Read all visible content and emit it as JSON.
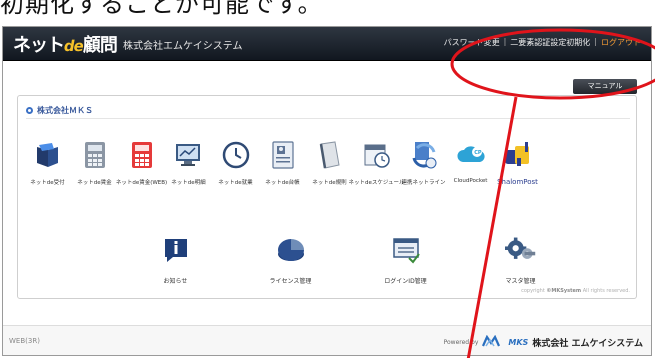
{
  "caption": "初期化することが可能です。",
  "header": {
    "logo_main": "ネット",
    "logo_de": "de",
    "logo_tail": "顧問",
    "company": "株式会社エムケイシステム",
    "links": [
      "パスワード変更",
      "二要素認証設定初期化",
      "ログアウト"
    ],
    "separator": "|"
  },
  "manual_label": "マニュアル",
  "panel": {
    "title": "株式会社ＭＫＳ",
    "apps": [
      {
        "label": "ネットde受付",
        "icon": "folder-arrow-icon"
      },
      {
        "label": "ネットde賃金",
        "icon": "calculator-icon"
      },
      {
        "label": "ネットde賃金(WEB)",
        "icon": "red-calculator-icon"
      },
      {
        "label": "ネットde明細",
        "icon": "monitor-chart-icon"
      },
      {
        "label": "ネットde就業",
        "icon": "clock-icon"
      },
      {
        "label": "ネットde台帳",
        "icon": "id-card-icon"
      },
      {
        "label": "ネットde規則",
        "icon": "document-icon"
      },
      {
        "label": "ネットdeスケジュール",
        "icon": "calendar-clock-icon"
      },
      {
        "label": "連携ネットライン",
        "icon": "sync-icon"
      },
      {
        "label": "CloudPocket",
        "icon": "cloud-icon"
      },
      {
        "label": "ShalomPost",
        "icon": "mailbox-icon"
      }
    ],
    "admin": [
      {
        "label": "お知らせ",
        "icon": "info-icon"
      },
      {
        "label": "ライセンス管理",
        "icon": "pie-license-icon"
      },
      {
        "label": "ログインID管理",
        "icon": "login-id-icon"
      },
      {
        "label": "マスタ管理",
        "icon": "gears-icon"
      }
    ],
    "copyright_prefix": "copyright",
    "copyright_brand": "©MKSystem",
    "copyright_suffix": "All rights reserved."
  },
  "footer": {
    "version": "WEB(3R)",
    "powered_by": "Powered by",
    "brand_mark": "MKS",
    "corp_name": "株式会社 エムケイシステム"
  },
  "colors": {
    "header_dark": "#1a2029",
    "logo_accent": "#f6c12a",
    "logout": "#f29a34",
    "annotation_red": "#e0141b",
    "title_blue": "#3a5a9c"
  }
}
